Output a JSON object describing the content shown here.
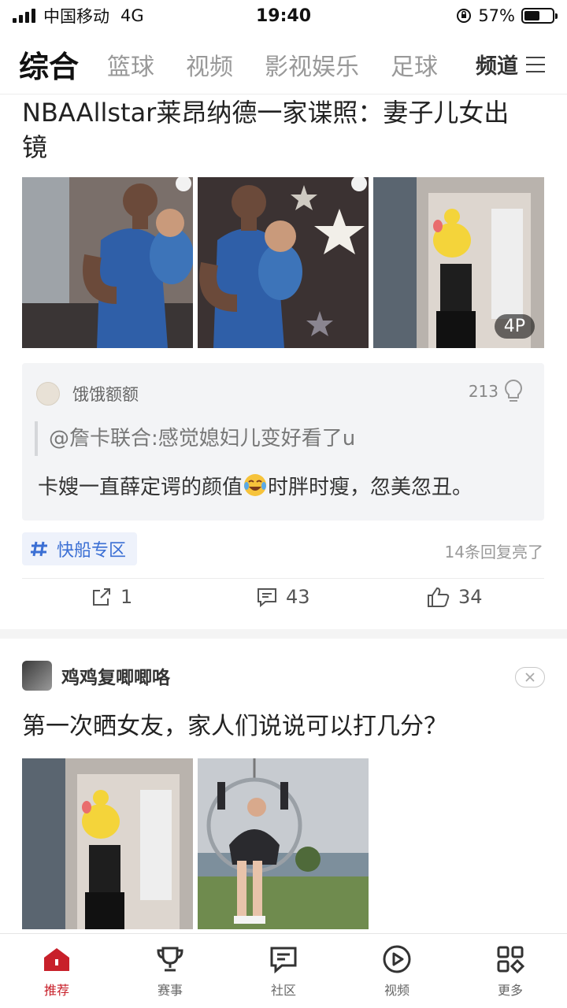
{
  "status_bar": {
    "carrier": "中国移动",
    "network": "4G",
    "time": "19:40",
    "battery": "57%",
    "battery_level": 0.57
  },
  "tabs": {
    "items": [
      "综合",
      "篮球",
      "视频",
      "影视娱乐",
      "足球"
    ],
    "active_index": 0,
    "channel_label": "频道"
  },
  "post1": {
    "title": "NBAAllstar莱昂纳德一家谍照：妻子儿女出镜",
    "image_count_badge": "4P",
    "comment": {
      "user": "饿饿额额",
      "likes": "213",
      "quote": "@詹卡联合:感觉媳妇儿变好看了u",
      "body_before_emoji": "卡嫂一直薛定谔的颜值",
      "body_after_emoji": "时胖时瘦，忽美忽丑。"
    },
    "topic": "快船专区",
    "reply_note": "14条回复亮了",
    "actions": {
      "share": "1",
      "comments": "43",
      "likes": "34"
    }
  },
  "post2": {
    "author": "鸡鸡复唧唧咯",
    "title": "第一次晒女友，家人们说说可以打几分？"
  },
  "bottom_nav": [
    {
      "label": "推荐",
      "icon": "home-icon"
    },
    {
      "label": "赛事",
      "icon": "trophy-icon"
    },
    {
      "label": "社区",
      "icon": "community-icon"
    },
    {
      "label": "视频",
      "icon": "video-icon"
    },
    {
      "label": "更多",
      "icon": "more-icon"
    }
  ],
  "colors": {
    "accent": "#c8202a",
    "topic_blue": "#3b6fd4"
  }
}
